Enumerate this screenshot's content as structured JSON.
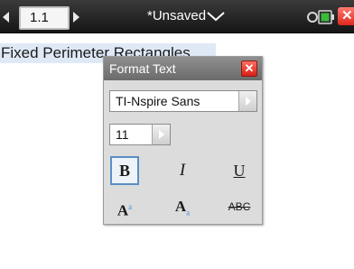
{
  "topbar": {
    "page_tab": "1.1",
    "doc_title": "*Unsaved",
    "title_menu_icon": "chevron-down-icon",
    "battery_icon": "battery-icon",
    "close_label": "✕",
    "colors": {
      "bar": "#1f1f1f",
      "close": "#e0271c",
      "battery": "#3cba3c"
    }
  },
  "document": {
    "text": "Fixed Perimeter Rectangles",
    "selection_color": "#dfe9f6"
  },
  "format_dialog": {
    "title": "Format Text",
    "close_label": "✕",
    "font_family": "TI-Nspire Sans",
    "font_size": "11",
    "buttons": {
      "bold": "B",
      "italic": "I",
      "underline": "U",
      "superscript_base": "A",
      "superscript_mark": "a",
      "subscript_base": "A",
      "subscript_mark": "a",
      "strikethrough": "ABC"
    },
    "selected": "bold",
    "accent_color": "#5a8fc4"
  }
}
